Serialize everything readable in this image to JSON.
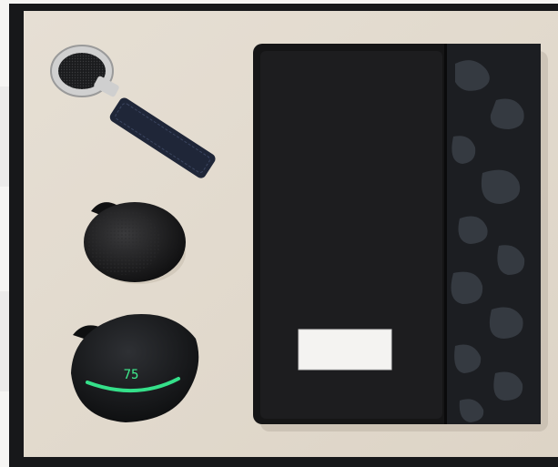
{
  "scene": {
    "description_label": "",
    "colors": {
      "background": "#f6f5f3",
      "box_frame": "#17181a",
      "tray": "#e3dbcf",
      "notebook_leather": "#151516",
      "camo_dark": "#1c1e22",
      "camo_light": "#3a3f47",
      "name_plate": "#f4f3f1",
      "keychain_strap": "#1f2638",
      "metal": "#c8c8c8",
      "speaker_body": "#161617",
      "earbud_case": "#121314",
      "led_green": "#35e08a"
    }
  },
  "earbuds_display": {
    "value": "75"
  }
}
